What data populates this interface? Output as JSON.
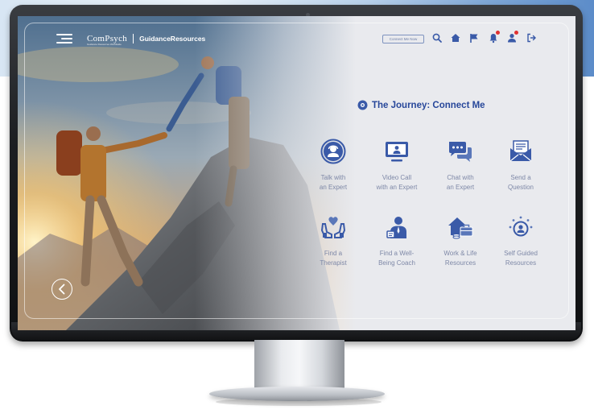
{
  "brand": {
    "logo_main": "ComPsych",
    "logo_sub": "Guidance Resources Worldwide",
    "logo_product": "GuidanceResources",
    "accent_color": "#27479a",
    "icon_color": "#3a5aa8"
  },
  "toolbar": {
    "connect_label": "Connect Me Now",
    "icons": [
      "search-icon",
      "home-icon",
      "flag-icon",
      "bell-icon",
      "notification-user-icon",
      "logout-icon"
    ]
  },
  "main": {
    "title": "The Journey: Connect Me",
    "tiles": [
      {
        "line1": "Talk with",
        "line2": "an Expert",
        "icon": "headset-person-icon"
      },
      {
        "line1": "Video Call",
        "line2": "with an Expert",
        "icon": "video-call-icon"
      },
      {
        "line1": "Chat with",
        "line2": "an Expert",
        "icon": "chat-bubbles-icon"
      },
      {
        "line1": "Send a",
        "line2": "Question",
        "icon": "envelope-icon"
      },
      {
        "line1": "Find a",
        "line2": "Therapist",
        "icon": "heart-hands-icon"
      },
      {
        "line1": "Find a Well-",
        "line2": "Being Coach",
        "icon": "coach-icon"
      },
      {
        "line1": "Work & Life",
        "line2": "Resources",
        "icon": "house-briefcase-icon"
      },
      {
        "line1": "Self Guided",
        "line2": "Resources",
        "icon": "self-guided-person-icon"
      }
    ]
  },
  "hero": {
    "back_icon": "chevron-left-icon"
  }
}
